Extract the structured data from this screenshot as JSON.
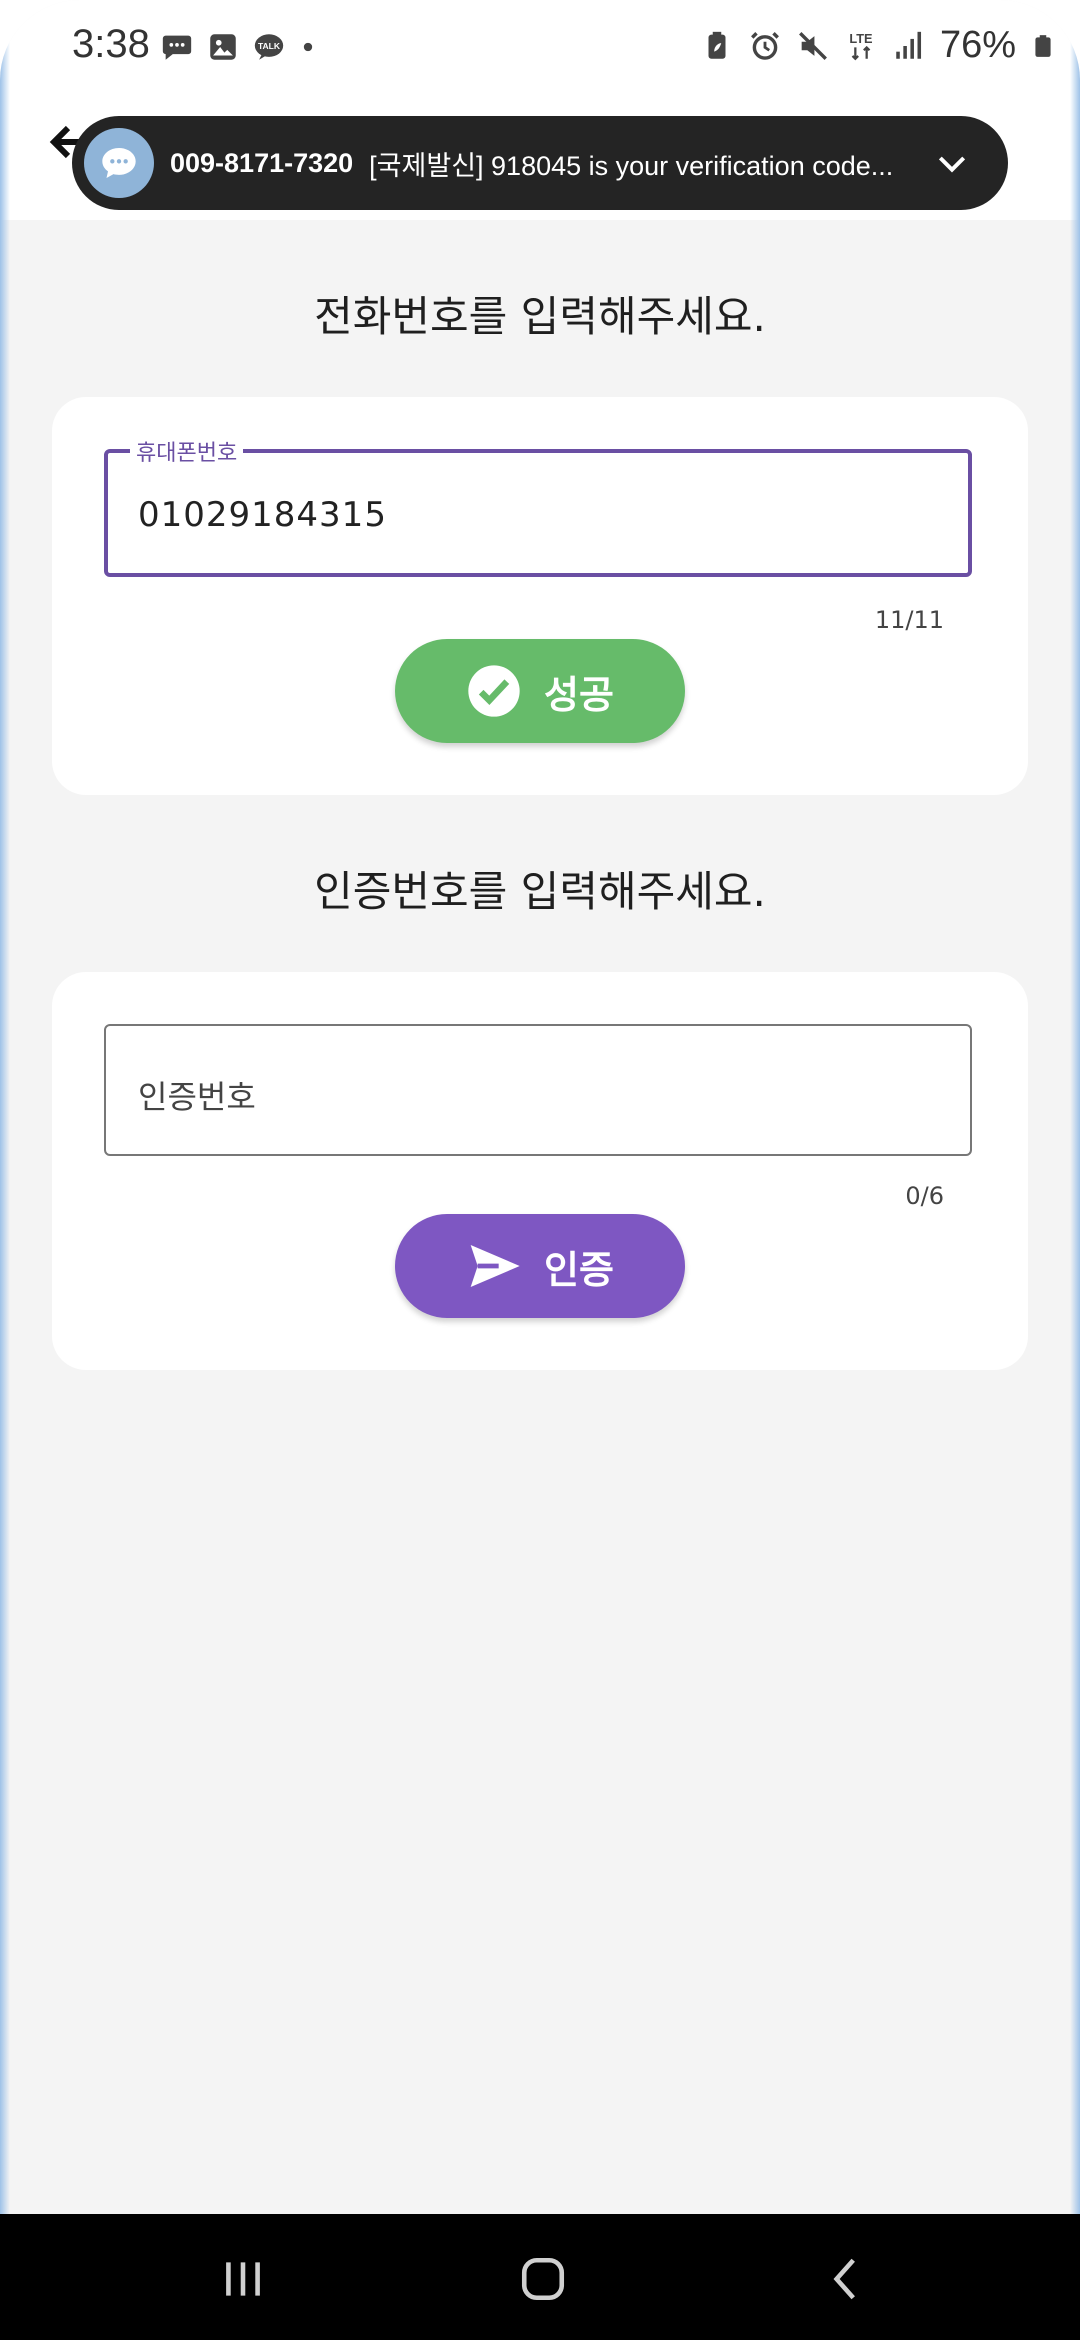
{
  "status_bar": {
    "time": "3:38",
    "battery": "76%",
    "left_icons": [
      "message-icon",
      "gallery-icon",
      "kakaotalk-icon",
      "dot-icon"
    ],
    "right_icons": [
      "battery-saver-icon",
      "alarm-icon",
      "mute-icon",
      "lte-icon",
      "signal-icon",
      "battery-icon"
    ]
  },
  "notification": {
    "sender": "009-8171-7320",
    "message": "[국제발신] 918045 is your verification code..."
  },
  "phone_section": {
    "title": "전화번호를 입력해주세요.",
    "field_label": "휴대폰번호",
    "field_value": "01029184315",
    "counter": "11/11",
    "button_label": "성공"
  },
  "code_section": {
    "title": "인증번호를 입력해주세요.",
    "field_placeholder": "인증번호",
    "counter": "0/6",
    "button_label": "인증"
  },
  "colors": {
    "accent": "#6a4fa3",
    "success": "#66bb6a",
    "verify": "#7e57c2",
    "background": "#f4f4f4"
  }
}
